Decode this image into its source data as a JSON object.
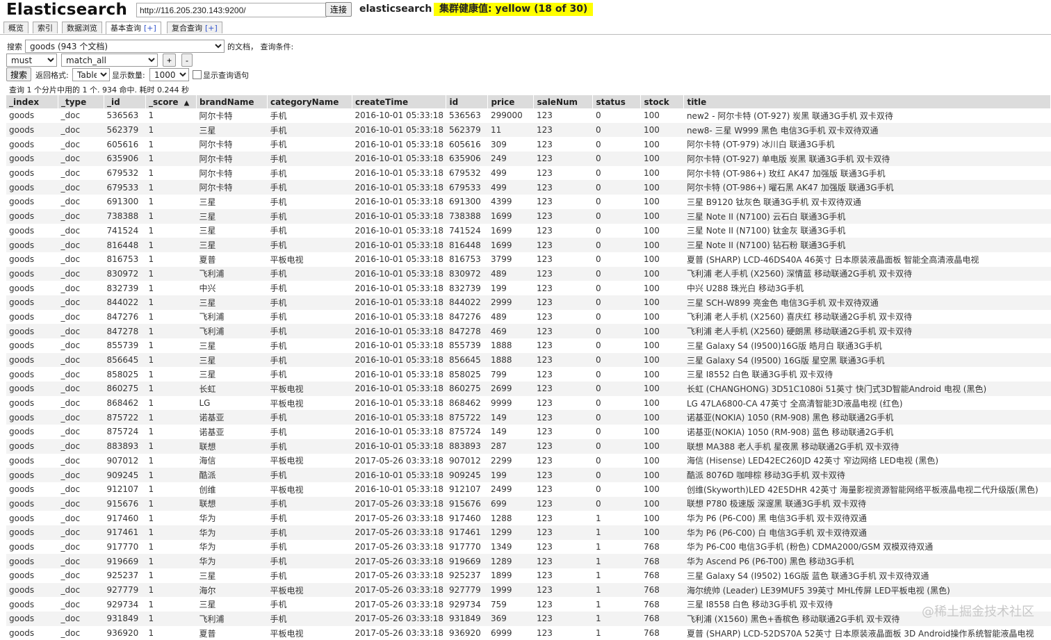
{
  "header": {
    "title": "Elasticsearch",
    "url": "http://116.205.230.143:9200/",
    "connect_label": "连接",
    "cluster_name": "elasticsearch",
    "health": "集群健康值: yellow (18 of 30)",
    "health_color": "#ffff00"
  },
  "tabs": [
    {
      "label": "概览",
      "plus": ""
    },
    {
      "label": "索引",
      "plus": ""
    },
    {
      "label": "数据浏览",
      "plus": ""
    },
    {
      "label": "基本查询",
      "plus": "[+]"
    },
    {
      "label": "复合查询",
      "plus": "[+]"
    }
  ],
  "query": {
    "search_label": "搜索",
    "index_select": "goods (943 个文档)",
    "docs_label": "的文档，  查询条件:",
    "bool_select": "must",
    "match_select": "match_all",
    "add_label": "+",
    "remove_label": "-",
    "search_button": "搜索",
    "format_label": "返回格式:",
    "format_select": "Table",
    "count_label": "显示数量:",
    "count_select": "1000",
    "show_raw_label": "显示查询语句"
  },
  "summary": "查询 1 个分片中用的 1 个. 934 命中. 耗时 0.244 秒",
  "table": {
    "columns": [
      "_index",
      "_type",
      "_id",
      "_score",
      "brandName",
      "categoryName",
      "createTime",
      "id",
      "price",
      "saleNum",
      "status",
      "stock",
      "title"
    ],
    "sort_indicator": "▲",
    "rows": [
      [
        "goods",
        "_doc",
        "536563",
        "1",
        "阿尔卡特",
        "手机",
        "2016-10-01 05:33:18",
        "536563",
        "299000",
        "123",
        "0",
        "100",
        "new2 - 阿尔卡特 (OT-927) 炭黑 联通3G手机 双卡双待"
      ],
      [
        "goods",
        "_doc",
        "562379",
        "1",
        "三星",
        "手机",
        "2016-10-01 05:33:18",
        "562379",
        "11",
        "123",
        "0",
        "100",
        "new8- 三星 W999 黑色 电信3G手机 双卡双待双通"
      ],
      [
        "goods",
        "_doc",
        "605616",
        "1",
        "阿尔卡特",
        "手机",
        "2016-10-01 05:33:18",
        "605616",
        "309",
        "123",
        "0",
        "100",
        "阿尔卡特 (OT-979) 冰川白 联通3G手机"
      ],
      [
        "goods",
        "_doc",
        "635906",
        "1",
        "阿尔卡特",
        "手机",
        "2016-10-01 05:33:18",
        "635906",
        "249",
        "123",
        "0",
        "100",
        "阿尔卡特 (OT-927) 单电版 炭黑 联通3G手机 双卡双待"
      ],
      [
        "goods",
        "_doc",
        "679532",
        "1",
        "阿尔卡特",
        "手机",
        "2016-10-01 05:33:18",
        "679532",
        "499",
        "123",
        "0",
        "100",
        "阿尔卡特 (OT-986+) 玫红 AK47 加强版 联通3G手机"
      ],
      [
        "goods",
        "_doc",
        "679533",
        "1",
        "阿尔卡特",
        "手机",
        "2016-10-01 05:33:18",
        "679533",
        "499",
        "123",
        "0",
        "100",
        "阿尔卡特 (OT-986+) 曜石黑 AK47 加强版 联通3G手机"
      ],
      [
        "goods",
        "_doc",
        "691300",
        "1",
        "三星",
        "手机",
        "2016-10-01 05:33:18",
        "691300",
        "4399",
        "123",
        "0",
        "100",
        "三星 B9120 钛灰色 联通3G手机 双卡双待双通"
      ],
      [
        "goods",
        "_doc",
        "738388",
        "1",
        "三星",
        "手机",
        "2016-10-01 05:33:18",
        "738388",
        "1699",
        "123",
        "0",
        "100",
        "三星 Note II (N7100) 云石白 联通3G手机"
      ],
      [
        "goods",
        "_doc",
        "741524",
        "1",
        "三星",
        "手机",
        "2016-10-01 05:33:18",
        "741524",
        "1699",
        "123",
        "0",
        "100",
        "三星 Note II (N7100) 钛金灰 联通3G手机"
      ],
      [
        "goods",
        "_doc",
        "816448",
        "1",
        "三星",
        "手机",
        "2016-10-01 05:33:18",
        "816448",
        "1699",
        "123",
        "0",
        "100",
        "三星 Note II (N7100) 钻石粉 联通3G手机"
      ],
      [
        "goods",
        "_doc",
        "816753",
        "1",
        "夏普",
        "平板电视",
        "2016-10-01 05:33:18",
        "816753",
        "3799",
        "123",
        "0",
        "100",
        "夏普 (SHARP) LCD-46DS40A 46英寸 日本原装液晶面板 智能全高清液晶电视"
      ],
      [
        "goods",
        "_doc",
        "830972",
        "1",
        "飞利浦",
        "手机",
        "2016-10-01 05:33:18",
        "830972",
        "489",
        "123",
        "0",
        "100",
        "飞利浦 老人手机 (X2560) 深情蓝 移动联通2G手机 双卡双待"
      ],
      [
        "goods",
        "_doc",
        "832739",
        "1",
        "中兴",
        "手机",
        "2016-10-01 05:33:18",
        "832739",
        "199",
        "123",
        "0",
        "100",
        "中兴 U288 珠光白 移动3G手机"
      ],
      [
        "goods",
        "_doc",
        "844022",
        "1",
        "三星",
        "手机",
        "2016-10-01 05:33:18",
        "844022",
        "2999",
        "123",
        "0",
        "100",
        "三星 SCH-W899 亮金色 电信3G手机 双卡双待双通"
      ],
      [
        "goods",
        "_doc",
        "847276",
        "1",
        "飞利浦",
        "手机",
        "2016-10-01 05:33:18",
        "847276",
        "489",
        "123",
        "0",
        "100",
        "飞利浦 老人手机 (X2560) 喜庆红 移动联通2G手机 双卡双待"
      ],
      [
        "goods",
        "_doc",
        "847278",
        "1",
        "飞利浦",
        "手机",
        "2016-10-01 05:33:18",
        "847278",
        "469",
        "123",
        "0",
        "100",
        "飞利浦 老人手机 (X2560) 硬朗黑 移动联通2G手机 双卡双待"
      ],
      [
        "goods",
        "_doc",
        "855739",
        "1",
        "三星",
        "手机",
        "2016-10-01 05:33:18",
        "855739",
        "1888",
        "123",
        "0",
        "100",
        "三星 Galaxy S4 (I9500)16G版 皓月白 联通3G手机"
      ],
      [
        "goods",
        "_doc",
        "856645",
        "1",
        "三星",
        "手机",
        "2016-10-01 05:33:18",
        "856645",
        "1888",
        "123",
        "0",
        "100",
        "三星 Galaxy S4 (I9500) 16G版 星空黑 联通3G手机"
      ],
      [
        "goods",
        "_doc",
        "858025",
        "1",
        "三星",
        "手机",
        "2016-10-01 05:33:18",
        "858025",
        "799",
        "123",
        "0",
        "100",
        "三星 I8552 白色 联通3G手机 双卡双待"
      ],
      [
        "goods",
        "_doc",
        "860275",
        "1",
        "长虹",
        "平板电视",
        "2016-10-01 05:33:18",
        "860275",
        "2699",
        "123",
        "0",
        "100",
        "长虹 (CHANGHONG) 3D51C1080i 51英寸 快门式3D智能Android 电视 (黑色)"
      ],
      [
        "goods",
        "_doc",
        "868462",
        "1",
        "LG",
        "平板电视",
        "2016-10-01 05:33:18",
        "868462",
        "9999",
        "123",
        "0",
        "100",
        "LG 47LA6800-CA 47英寸 全高清智能3D液晶电视 (红色)"
      ],
      [
        "goods",
        "_doc",
        "875722",
        "1",
        "诺基亚",
        "手机",
        "2016-10-01 05:33:18",
        "875722",
        "149",
        "123",
        "0",
        "100",
        "诺基亚(NOKIA) 1050 (RM-908) 黑色 移动联通2G手机"
      ],
      [
        "goods",
        "_doc",
        "875724",
        "1",
        "诺基亚",
        "手机",
        "2016-10-01 05:33:18",
        "875724",
        "149",
        "123",
        "0",
        "100",
        "诺基亚(NOKIA) 1050 (RM-908) 蓝色 移动联通2G手机"
      ],
      [
        "goods",
        "_doc",
        "883893",
        "1",
        "联想",
        "手机",
        "2016-10-01 05:33:18",
        "883893",
        "287",
        "123",
        "0",
        "100",
        "联想 MA388 老人手机 星夜黑 移动联通2G手机 双卡双待"
      ],
      [
        "goods",
        "_doc",
        "907012",
        "1",
        "海信",
        "平板电视",
        "2017-05-26 03:33:18",
        "907012",
        "2299",
        "123",
        "0",
        "100",
        "海信 (Hisense) LED42EC260JD 42英寸 窄边网络 LED电视 (黑色)"
      ],
      [
        "goods",
        "_doc",
        "909245",
        "1",
        "酷派",
        "手机",
        "2016-10-01 05:33:18",
        "909245",
        "199",
        "123",
        "0",
        "100",
        "酷派 8076D 咖啡棕 移动3G手机 双卡双待"
      ],
      [
        "goods",
        "_doc",
        "912107",
        "1",
        "创维",
        "平板电视",
        "2016-10-01 05:33:18",
        "912107",
        "2499",
        "123",
        "0",
        "100",
        "创维(Skyworth)LED 42E5DHR 42英寸 海量影视资源智能网络平板液晶电视二代升级版(黑色)"
      ],
      [
        "goods",
        "_doc",
        "915676",
        "1",
        "联想",
        "手机",
        "2017-05-26 03:33:18",
        "915676",
        "699",
        "123",
        "0",
        "100",
        "联想 P780 极速版 深邃黑 联通3G手机 双卡双待"
      ],
      [
        "goods",
        "_doc",
        "917460",
        "1",
        "华为",
        "手机",
        "2017-05-26 03:33:18",
        "917460",
        "1288",
        "123",
        "1",
        "100",
        "华为 P6 (P6-C00) 黑 电信3G手机 双卡双待双通"
      ],
      [
        "goods",
        "_doc",
        "917461",
        "1",
        "华为",
        "手机",
        "2017-05-26 03:33:18",
        "917461",
        "1299",
        "123",
        "1",
        "100",
        "华为 P6 (P6-C00) 白 电信3G手机 双卡双待双通"
      ],
      [
        "goods",
        "_doc",
        "917770",
        "1",
        "华为",
        "手机",
        "2017-05-26 03:33:18",
        "917770",
        "1349",
        "123",
        "1",
        "768",
        "华为 P6-C00 电信3G手机 (粉色) CDMA2000/GSM 双模双待双通"
      ],
      [
        "goods",
        "_doc",
        "919669",
        "1",
        "华为",
        "手机",
        "2017-05-26 03:33:18",
        "919669",
        "1289",
        "123",
        "1",
        "768",
        "华为 Ascend P6 (P6-T00) 黑色 移动3G手机"
      ],
      [
        "goods",
        "_doc",
        "925237",
        "1",
        "三星",
        "手机",
        "2017-05-26 03:33:18",
        "925237",
        "1899",
        "123",
        "1",
        "768",
        "三星 Galaxy S4 (I9502) 16G版 蓝色 联通3G手机 双卡双待双通"
      ],
      [
        "goods",
        "_doc",
        "927779",
        "1",
        "海尔",
        "平板电视",
        "2017-05-26 03:33:18",
        "927779",
        "1999",
        "123",
        "1",
        "768",
        "海尔统帅 (Leader) LE39MUF5 39英寸 MHL传屏 LED平板电视 (黑色)"
      ],
      [
        "goods",
        "_doc",
        "929734",
        "1",
        "三星",
        "手机",
        "2017-05-26 03:33:18",
        "929734",
        "759",
        "123",
        "1",
        "768",
        "三星 I8558 白色 移动3G手机 双卡双待"
      ],
      [
        "goods",
        "_doc",
        "931849",
        "1",
        "飞利浦",
        "手机",
        "2017-05-26 03:33:18",
        "931849",
        "369",
        "123",
        "1",
        "768",
        "飞利浦 (X1560) 黑色+香槟色 移动联通2G手机 双卡双待"
      ],
      [
        "goods",
        "_doc",
        "936920",
        "1",
        "夏普",
        "平板电视",
        "2017-05-26 03:33:18",
        "936920",
        "6999",
        "123",
        "1",
        "768",
        "夏普 (SHARP) LCD-52DS70A 52英寸 日本原装液晶面板 3D Android操作系统智能液晶电视"
      ]
    ]
  },
  "watermark": "@稀土掘金技术社区"
}
